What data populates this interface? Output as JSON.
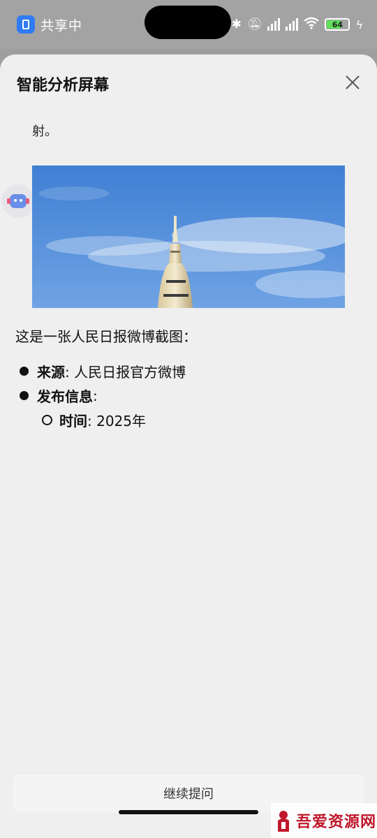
{
  "status_bar": {
    "share_label": "共享中",
    "battery_level": "64",
    "icons": [
      "bluetooth-icon",
      "bell-muted-icon",
      "signal-icon",
      "signal-icon",
      "wifi-icon",
      "battery-icon",
      "charging-icon"
    ]
  },
  "sheet": {
    "title": "智能分析屏幕",
    "close_icon": "close-icon"
  },
  "chat": {
    "previous_fragment": "射。",
    "image_icon": "rocket-launch-photo",
    "intro": "这是一张人民日报微博截图：",
    "items": [
      {
        "label": "来源",
        "value": ": 人民日报官方微博"
      },
      {
        "label": "发布信息",
        "value": ":"
      }
    ],
    "sub_items": [
      {
        "label": "时间",
        "value": ": 2025年"
      }
    ]
  },
  "footer": {
    "followup_label": "继续提问"
  },
  "watermark": {
    "text": "吾爱资源网"
  },
  "colors": {
    "sheet_bg": "#efefef",
    "accent_blue": "#2f7cf6",
    "watermark_red": "#c0172a"
  }
}
